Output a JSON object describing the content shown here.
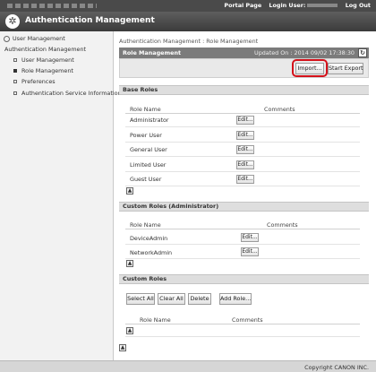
{
  "topbar": {
    "portal_label": "Portal Page",
    "login_label": "Login User:",
    "logout_label": "Log Out"
  },
  "app": {
    "title": "Authentication Management"
  },
  "sidebar": {
    "items": [
      {
        "label": "User Management"
      },
      {
        "label": "Authentication Management"
      },
      {
        "label": "User Management"
      },
      {
        "label": "Role Management"
      },
      {
        "label": "Preferences"
      },
      {
        "label": "Authentication Service Information"
      }
    ]
  },
  "breadcrumb": "Authentication Management : Role Management",
  "role_management": {
    "title": "Role Management",
    "updated": "Updated On : 2014 09/02 17:38:30",
    "import_label": "Import...",
    "export_label": "Start Export"
  },
  "base_roles": {
    "title": "Base Roles",
    "col_name": "Role Name",
    "col_comments": "Comments",
    "edit_label": "Edit...",
    "rows": [
      {
        "name": "Administrator"
      },
      {
        "name": "Power User"
      },
      {
        "name": "General User"
      },
      {
        "name": "Limited User"
      },
      {
        "name": "Guest User"
      }
    ]
  },
  "custom_admin_roles": {
    "title": "Custom Roles (Administrator)",
    "col_name": "Role Name",
    "col_comments": "Comments",
    "edit_label": "Edit...",
    "rows": [
      {
        "name": "DeviceAdmin"
      },
      {
        "name": "NetworkAdmin"
      }
    ]
  },
  "custom_roles": {
    "title": "Custom Roles",
    "select_all_label": "Select All",
    "clear_all_label": "Clear All",
    "delete_label": "Delete",
    "add_role_label": "Add Role...",
    "col_name": "Role Name",
    "col_comments": "Comments"
  },
  "footer": {
    "copyright": "Copyright CANON INC."
  }
}
